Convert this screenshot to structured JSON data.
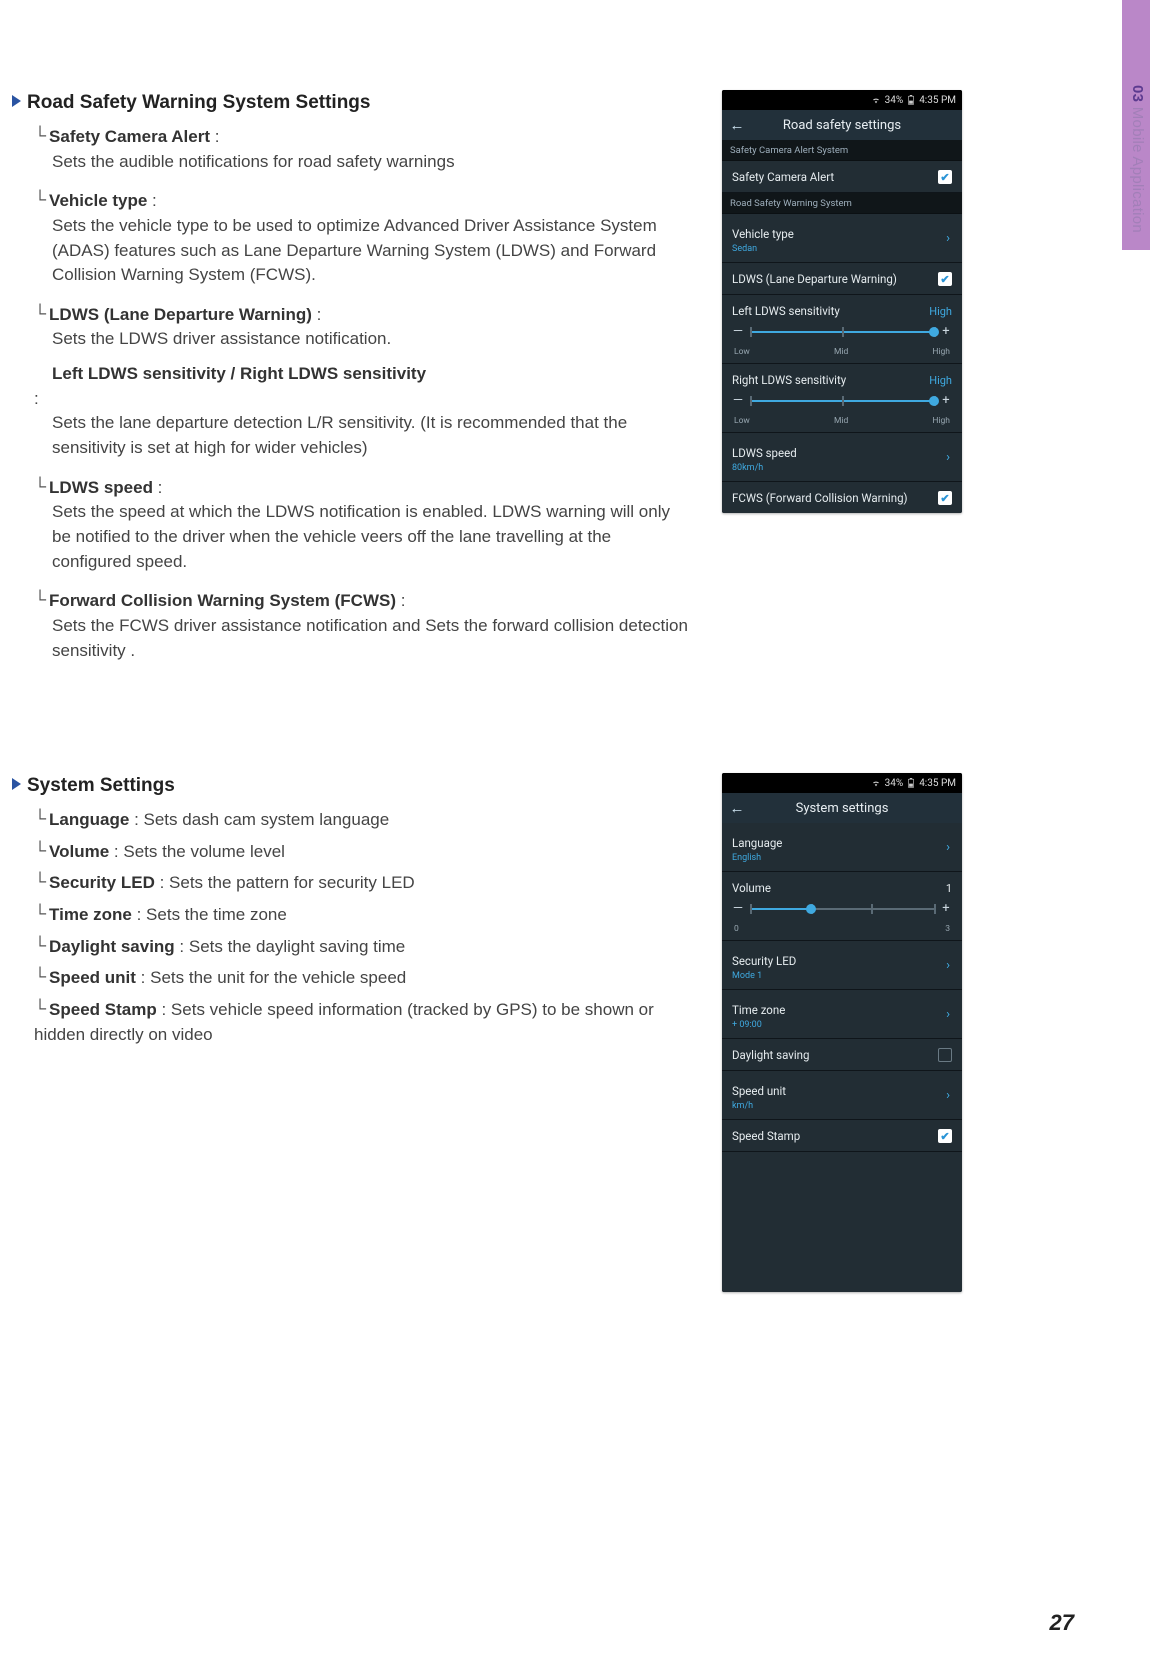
{
  "sidetab": {
    "chapter": "03",
    "title": " Mobile Application"
  },
  "page_number": "27",
  "statusbar": {
    "battery": "34%",
    "time": "4:35 PM"
  },
  "road": {
    "heading": "Road Safety Warning System Settings",
    "items": {
      "sca": {
        "name": "Safety Camera Alert",
        "desc": "Sets the audible notifications for road safety warnings"
      },
      "veh": {
        "name": "Vehicle type",
        "desc": "Sets the vehicle type to be used to optimize Advanced Driver Assistance System (ADAS) features such as Lane Departure Warning System (LDWS) and Forward Collision Warning System (FCWS)."
      },
      "ldws": {
        "name": "LDWS (Lane Departure Warning)",
        "desc": "Sets the LDWS driver assistance notification."
      },
      "sens": {
        "name": "Left LDWS sensitivity / Right LDWS sensitivity",
        "desc": "Sets the lane departure detection L/R sensitivity. (It is recommended that the sensitivity is set at high for wider vehicles)"
      },
      "spd": {
        "name": "LDWS speed",
        "desc": "Sets the speed at which the LDWS notification is enabled.  LDWS warning will only be notified to the driver when the vehicle veers off the lane travelling at the configured speed."
      },
      "fcws": {
        "name": "Forward Collision Warning System (FCWS)",
        "desc": "Sets the FCWS driver assistance notification and Sets the forward collision detection sensitivity ."
      }
    },
    "phone": {
      "title": "Road safety settings",
      "grp1": "Safety Camera Alert System",
      "row_sca": "Safety Camera Alert",
      "grp2": "Road Safety Warning System",
      "row_veh": {
        "label": "Vehicle type",
        "sub": "Sedan"
      },
      "row_ldws": "LDWS (Lane Departure Warning)",
      "row_left": {
        "label": "Left LDWS sensitivity",
        "val": "High"
      },
      "row_right": {
        "label": "Right LDWS sensitivity",
        "val": "High"
      },
      "ticks": {
        "low": "Low",
        "mid": "Mid",
        "high": "High"
      },
      "row_spd": {
        "label": "LDWS speed",
        "sub": "80km/h"
      },
      "row_fcws": "FCWS (Forward Collision Warning)"
    }
  },
  "system": {
    "heading": "System Settings",
    "items": {
      "lang": {
        "name": "Language",
        "desc": "Sets dash cam system language"
      },
      "vol": {
        "name": "Volume",
        "desc": "Sets the volume level"
      },
      "led": {
        "name": "Security LED",
        "desc": " Sets the pattern for security LED"
      },
      "tz": {
        "name": "Time zone",
        "desc": "Sets the time zone"
      },
      "ds": {
        "name": "Daylight saving",
        "desc": "Sets the daylight saving time"
      },
      "su": {
        "name": "Speed unit",
        "desc": "Sets the unit for the vehicle speed"
      },
      "ss": {
        "name": "Speed Stamp",
        "desc": "Sets vehicle speed information (tracked by GPS) to be shown or hidden directly on video"
      }
    },
    "phone": {
      "title": "System settings",
      "row_lang": {
        "label": "Language",
        "sub": "English"
      },
      "row_vol": {
        "label": "Volume",
        "val": "1",
        "min": "0",
        "max": "3"
      },
      "row_led": {
        "label": "Security LED",
        "sub": "Mode 1"
      },
      "row_tz": {
        "label": "Time zone",
        "sub": "+ 09:00"
      },
      "row_ds": "Daylight saving",
      "row_su": {
        "label": "Speed unit",
        "sub": "km/h"
      },
      "row_ss": "Speed Stamp"
    }
  }
}
